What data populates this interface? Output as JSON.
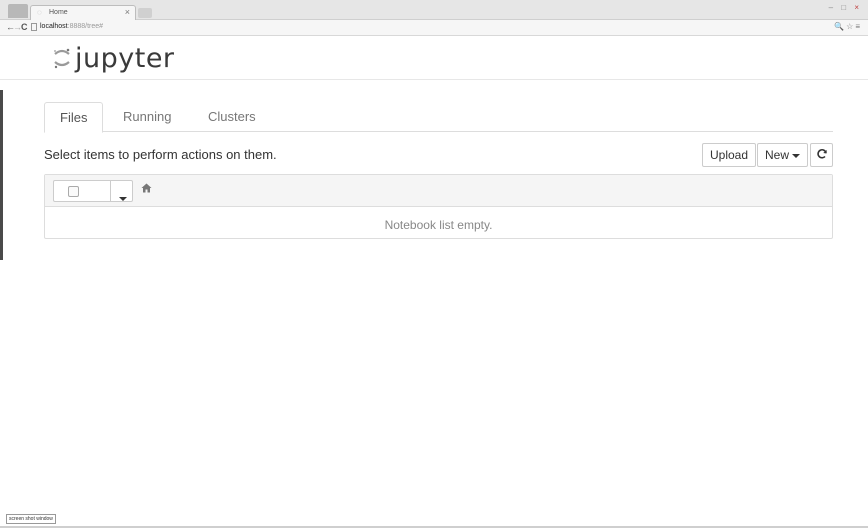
{
  "browser": {
    "tab_title": "Home",
    "tab_close": "×",
    "url_host": "localhost",
    "url_path": ":8888/tree#",
    "nav_back": "←",
    "nav_forward": "→",
    "nav_reload": "C",
    "win_min": "–",
    "win_max": "□",
    "win_close": "×",
    "toolbar_right": "🔍☆≡"
  },
  "header": {
    "logo_text": "jupyter"
  },
  "tabs": [
    {
      "label": "Files",
      "active": true
    },
    {
      "label": "Running",
      "active": false
    },
    {
      "label": "Clusters",
      "active": false
    }
  ],
  "main": {
    "select_message": "Select items to perform actions on them.",
    "upload_label": "Upload",
    "new_label": "New",
    "refresh_icon": "refresh-icon",
    "empty_message": "Notebook list empty."
  },
  "footer": {
    "status_label": "screen shot window"
  },
  "colors": {
    "logo_orange": "#9a9a9a",
    "border": "#dddddd",
    "list_header_bg": "#f5f5f5"
  }
}
